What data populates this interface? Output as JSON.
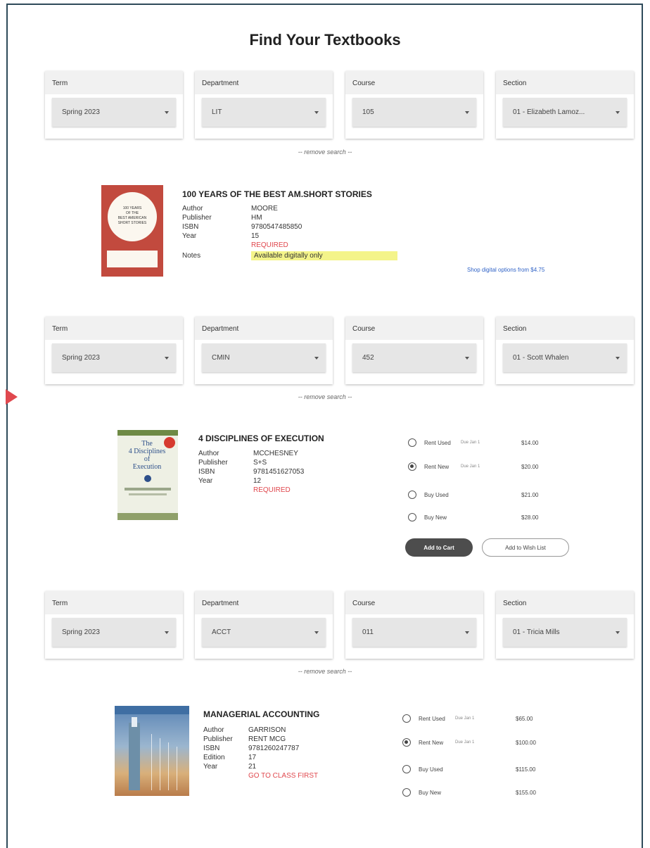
{
  "page": {
    "title": "Find Your Textbooks"
  },
  "labels": {
    "term": "Term",
    "department": "Department",
    "course": "Course",
    "section": "Section",
    "remove": "-- remove search --"
  },
  "searches": [
    {
      "term": "Spring 2023",
      "department": "LIT",
      "course": "105",
      "section": "01 - Elizabeth Lamoz...",
      "book": {
        "title": "100 YEARS OF THE BEST AM.SHORT STORIES",
        "cover_text": [
          "100 YEARS",
          "OF THE",
          "BEST AMERICAN",
          "SHORT STORIES"
        ],
        "author_label": "Author",
        "author": "MOORE",
        "publisher_label": "Publisher",
        "publisher": "HM",
        "isbn_label": "ISBN",
        "isbn": "9780547485850",
        "year_label": "Year",
        "year": "15",
        "status": "REQUIRED",
        "notes_label": "Notes",
        "notes": "Available digitally only",
        "digital_link": "Shop digital options from $4.75"
      }
    },
    {
      "term": "Spring 2023",
      "department": "CMIN",
      "course": "452",
      "section": "01 - Scott Whalen",
      "book": {
        "title": "4 DISCIPLINES OF EXECUTION",
        "cover_text": [
          "The",
          "4 Disciplines",
          "of",
          "Execution"
        ],
        "author_label": "Author",
        "author": "MCCHESNEY",
        "publisher_label": "Publisher",
        "publisher": "S+S",
        "isbn_label": "ISBN",
        "isbn": "9781451627053",
        "year_label": "Year",
        "year": "12",
        "status": "REQUIRED",
        "options": [
          {
            "label": "Rent Used",
            "note": "Due Jan 1",
            "price": "$14.00",
            "selected": false
          },
          {
            "label": "Rent New",
            "note": "Due Jan 1",
            "price": "$20.00",
            "selected": true
          },
          {
            "label": "Buy Used",
            "note": "",
            "price": "$21.00",
            "selected": false
          },
          {
            "label": "Buy New",
            "note": "",
            "price": "$28.00",
            "selected": false
          }
        ],
        "add_to_cart": "Add to Cart",
        "add_to_wishlist": "Add to Wish List"
      }
    },
    {
      "term": "Spring 2023",
      "department": "ACCT",
      "course": "011",
      "section": "01 - Tricia Mills",
      "book": {
        "title": "MANAGERIAL ACCOUNTING",
        "author_label": "Author",
        "author": "GARRISON",
        "publisher_label": "Publisher",
        "publisher": "RENT MCG",
        "isbn_label": "ISBN",
        "isbn": "9781260247787",
        "edition_label": "Edition",
        "edition": "17",
        "year_label": "Year",
        "year": "21",
        "status": "GO TO CLASS FIRST",
        "options": [
          {
            "label": "Rent Used",
            "note": "Due Jan 1",
            "price": "$65.00",
            "selected": false
          },
          {
            "label": "Rent New",
            "note": "Due Jan 1",
            "price": "$100.00",
            "selected": true
          },
          {
            "label": "Buy Used",
            "note": "",
            "price": "$115.00",
            "selected": false
          },
          {
            "label": "Buy New",
            "note": "",
            "price": "$155.00",
            "selected": false
          }
        ]
      }
    }
  ],
  "colors": {
    "accent_red": "#e0484e",
    "highlight": "#f4f48a",
    "link_blue": "#2f62c6",
    "button_dark": "#4d4d4d"
  }
}
